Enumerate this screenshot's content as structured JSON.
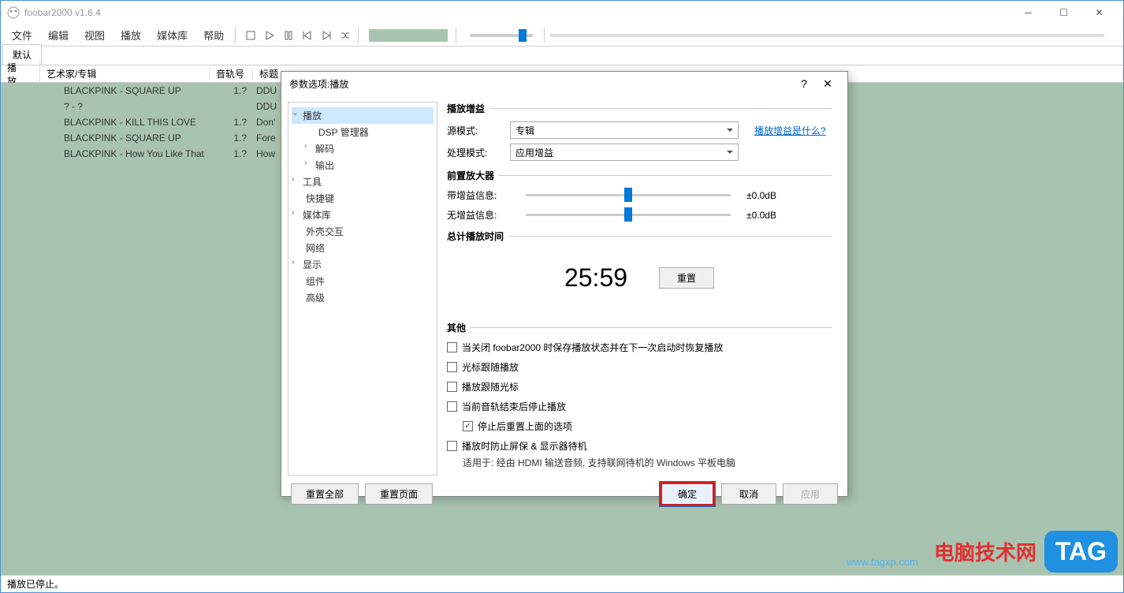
{
  "window": {
    "title": "foobar2000 v1.6.4"
  },
  "menu": {
    "file": "文件",
    "edit": "编辑",
    "view": "视图",
    "play": "播放",
    "library": "媒体库",
    "help": "帮助"
  },
  "tab": {
    "default": "默认"
  },
  "columns": {
    "playing": "播放...",
    "artist": "艺术家/专辑",
    "track": "音轨号",
    "title": "标题"
  },
  "playlist": [
    {
      "artist": "BLACKPINK - SQUARE UP",
      "track": "1.?",
      "title": "DDU"
    },
    {
      "artist": "? - ?",
      "track": "",
      "title": "DDU"
    },
    {
      "artist": "BLACKPINK - KILL THIS LOVE",
      "track": "1.?",
      "title": "Don'"
    },
    {
      "artist": "BLACKPINK - SQUARE UP",
      "track": "1.?",
      "title": "Fore"
    },
    {
      "artist": "BLACKPINK - How You Like That",
      "track": "1.?",
      "title": "How"
    }
  ],
  "status": {
    "text": "播放已停止。"
  },
  "dialog": {
    "title": "参数选项:播放",
    "tree": {
      "playback": "播放",
      "dsp": "DSP 管理器",
      "decode": "解码",
      "output": "输出",
      "tools": "工具",
      "hotkeys": "快捷键",
      "library": "媒体库",
      "shell": "外壳交互",
      "network": "网络",
      "display": "显示",
      "components": "组件",
      "advanced": "高级"
    },
    "gain": {
      "title": "播放增益",
      "sourceMode": "源模式:",
      "sourceValue": "专辑",
      "processMode": "处理模式:",
      "processValue": "应用增益",
      "link": "播放增益是什么?"
    },
    "preamp": {
      "title": "前置放大器",
      "withGain": "带增益信息:",
      "withGainVal": "±0.0dB",
      "noGain": "无增益信息:",
      "noGainVal": "±0.0dB"
    },
    "total": {
      "title": "总计播放时间",
      "time": "25:59",
      "reset": "重置"
    },
    "other": {
      "title": "其他",
      "c1": "当关闭 foobar2000 时保存播放状态并在下一次启动时恢复播放",
      "c2": "光标跟随播放",
      "c3": "播放跟随光标",
      "c4": "当前音轨结束后停止播放",
      "c5": "停止后重置上面的选项",
      "c6": "播放时防止屏保 & 显示器待机",
      "note": "适用于: 经由 HDMI 输送音频, 支持联网待机的 Windows 平板电脑"
    },
    "buttons": {
      "resetAll": "重置全部",
      "resetPage": "重置页面",
      "ok": "确定",
      "cancel": "取消",
      "apply": "应用"
    }
  },
  "watermark": {
    "text": "电脑技术网",
    "url": "www.tagxp.com",
    "tag": "TAG"
  }
}
